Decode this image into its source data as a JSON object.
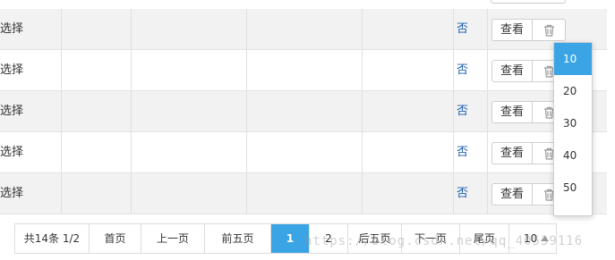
{
  "table": {
    "rows": [
      {
        "status": "未选择",
        "flag": "否",
        "view_label": "查看"
      },
      {
        "status": "未选择",
        "flag": "否",
        "view_label": "查看"
      },
      {
        "status": "未选择",
        "flag": "否",
        "view_label": "查看"
      },
      {
        "status": "未选择",
        "flag": "否",
        "view_label": "查看"
      },
      {
        "status": "未选择",
        "flag": "否",
        "view_label": "查看"
      }
    ],
    "delete_icon": "trash-icon"
  },
  "pager": {
    "summary": "共14条  1/2",
    "first": "首页",
    "prev": "上一页",
    "prev5": "前五页",
    "pages": [
      "1",
      "2"
    ],
    "current_page": "1",
    "next5": "后五页",
    "next": "下一页",
    "last": "尾页",
    "page_size": "10"
  },
  "page_size_dropdown": {
    "options": [
      "10",
      "20",
      "30",
      "40",
      "50"
    ],
    "selected": "10"
  },
  "watermark": "https://blog.csdn.net/qq_40539116",
  "colors": {
    "accent": "#3ba4e4",
    "link_blue": "#1e5fb0",
    "row_alt": "#f2f2f2"
  }
}
